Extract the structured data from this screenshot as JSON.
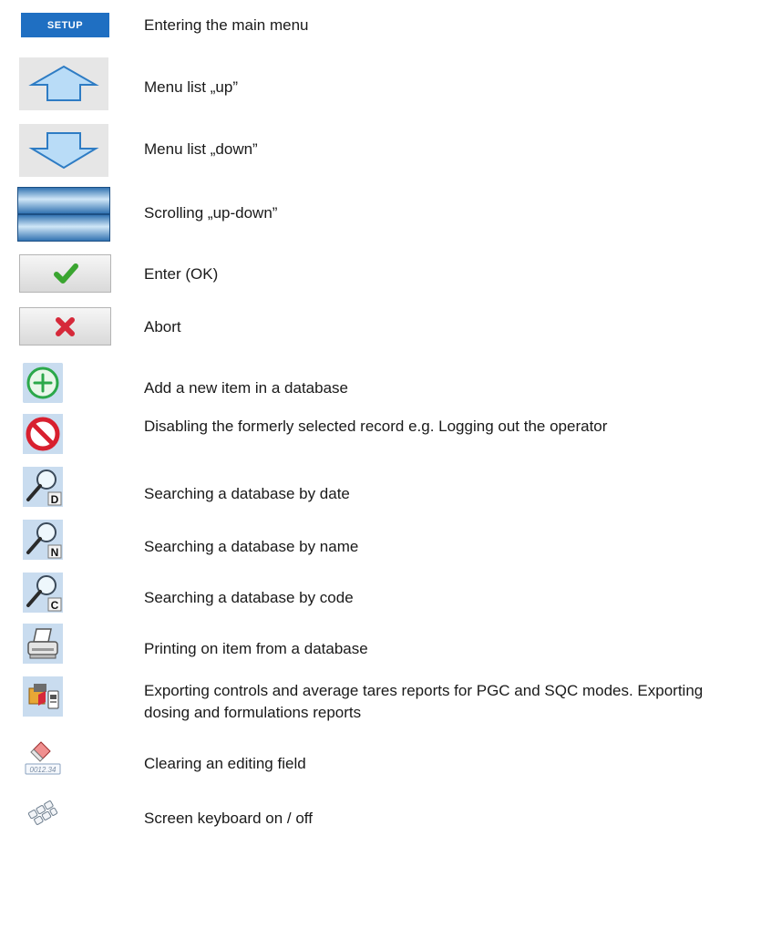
{
  "setup_label": "SETUP",
  "items": [
    {
      "icon": "setup-button-icon",
      "text": "Entering the main menu"
    },
    {
      "icon": "arrow-up-icon",
      "text": "Menu list „up”"
    },
    {
      "icon": "arrow-down-icon",
      "text": "Menu list „down”"
    },
    {
      "icon": "scroll-up-down-icon",
      "text": "Scrolling „up-down”"
    },
    {
      "icon": "checkmark-icon",
      "text": "Enter (OK)"
    },
    {
      "icon": "abort-x-icon",
      "text": "Abort"
    },
    {
      "icon": "add-plus-icon",
      "text": "Add a new item in a database"
    },
    {
      "icon": "disable-no-icon",
      "text": "Disabling the formerly selected record e.g. Logging out the operator"
    },
    {
      "icon": "search-date-icon",
      "text": "Searching a database by date"
    },
    {
      "icon": "search-name-icon",
      "text": "Searching a database by name"
    },
    {
      "icon": "search-code-icon",
      "text": "Searching a database by code"
    },
    {
      "icon": "printer-icon",
      "text": "Printing on item from a database"
    },
    {
      "icon": "export-reports-icon",
      "text": "Exporting controls and average tares reports for PGC and SQC modes. Exporting dosing and formulations reports"
    },
    {
      "icon": "eraser-clear-icon",
      "text": "Clearing an editing field"
    },
    {
      "icon": "keyboard-icon",
      "text": "Screen keyboard on / off"
    }
  ],
  "search_letters": [
    "D",
    "N",
    "C"
  ],
  "eraser_field_text": "0012.34",
  "colors": {
    "setup_blue": "#1f6fc2",
    "tile_blue": "#c9dcef",
    "check_green": "#3aa530",
    "abort_red": "#d6293a",
    "plus_green": "#2ba84a",
    "no_red": "#d8202f"
  }
}
